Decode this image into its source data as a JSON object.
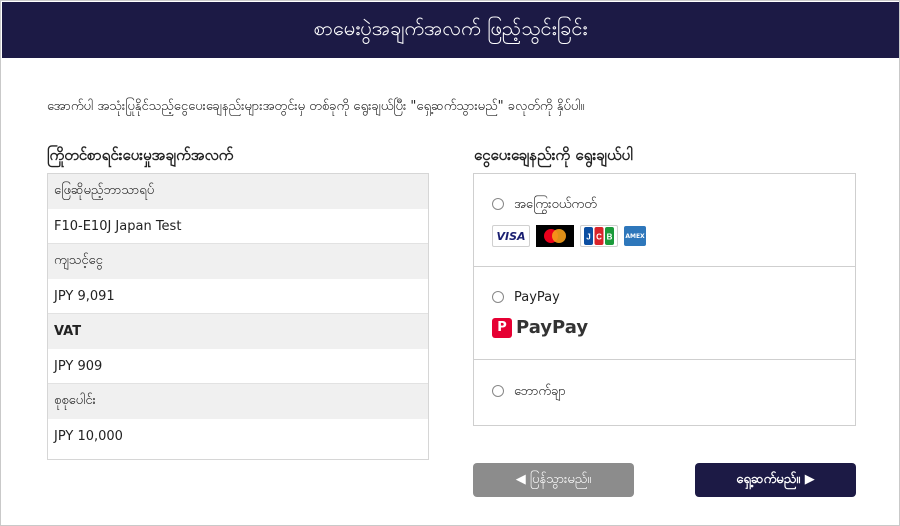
{
  "page": {
    "title": "စာမေးပွဲအချက်အလက် ဖြည့်သွင်းခြင်း",
    "intro": "အောက်ပါ အသုံးပြုနိုင်သည့်ငွေပေးချေနည်းများအတွင်းမှ တစ်ခုကို ရွေးချယ်ပြီး \"ရှေ့ဆက်သွားမည်\" ခလုတ်ကို နှိပ်ပါ။"
  },
  "summary": {
    "title": "ကြိုတင်စာရင်းပေးမှုအချက်အလက်",
    "rows": [
      {
        "label": "ဖြေဆိုမည့်ဘာသာရပ်",
        "value": "F10-E10J  Japan  Test"
      },
      {
        "label": "ကျသင့်ငွေ",
        "value": "JPY 9,091"
      },
      {
        "label": "VAT",
        "value": "JPY 909"
      },
      {
        "label": "စုစုပေါင်း",
        "value": "JPY 10,000"
      }
    ]
  },
  "payment": {
    "title": "ငွေပေးချေနည်းကို ရွေးချယ်ပါ",
    "options": [
      {
        "label": "အကြွေးဝယ်ကတ်",
        "logos": [
          "VISA",
          "mastercard",
          "JCB",
          "AMEX"
        ]
      },
      {
        "label": "PayPay",
        "logo_text": "PayPay",
        "logo_mark": "P"
      },
      {
        "label": "ဘောက်ချာ"
      }
    ]
  },
  "buttons": {
    "back": "◀ ပြန်သွားမည်။",
    "next": "ရှေ့ဆက်မည်။ ▶"
  },
  "colors": {
    "header_bg": "#1c1a45",
    "back_button": "#8c8c8c",
    "next_button": "#1c1a45",
    "paypay_red": "#e60033"
  }
}
